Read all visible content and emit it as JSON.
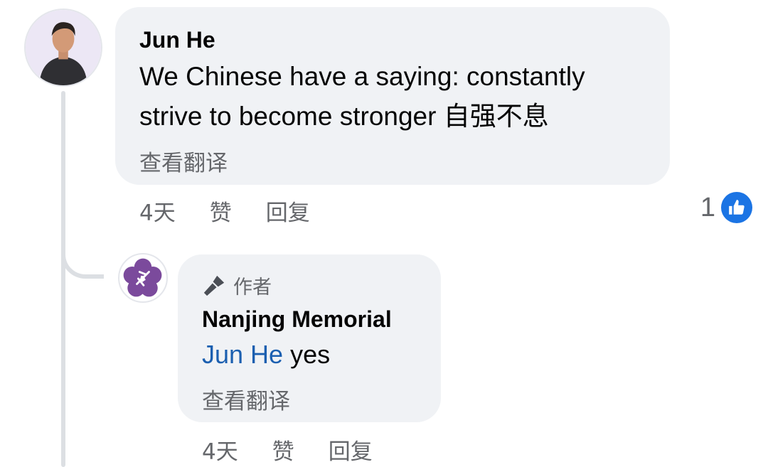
{
  "comment": {
    "author": "Jun He",
    "text_line1": "We Chinese have a saying: constantly",
    "text_line2": "strive to become stronger 自强不息",
    "see_translation": "查看翻译",
    "time": "4天",
    "like_label": "赞",
    "reply_label": "回复",
    "reaction_count": "1",
    "avatar_icon": "person-avatar-icon",
    "reaction_icon": "thumbs-up-icon",
    "reaction_color": "#1b74e4"
  },
  "reply": {
    "badge_label": "作者",
    "badge_icon": "microphone-icon",
    "author": "Nanjing Memorial",
    "mention": "Jun He",
    "text": "yes",
    "see_translation": "查看翻译",
    "time": "4天",
    "like_label": "赞",
    "reply_label": "回复",
    "avatar_icon": "purple-flower-logo-icon",
    "mention_color": "#1b5fb0"
  }
}
